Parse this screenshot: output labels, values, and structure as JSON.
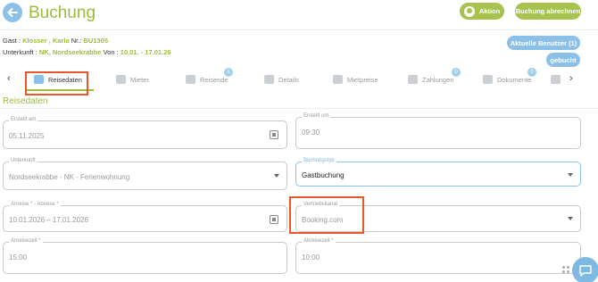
{
  "header": {
    "title": "Buchung",
    "aktion_label": "Aktion",
    "abrechnen_label": "Buchung abrechnen"
  },
  "info": {
    "gast_label": "Gast :",
    "gast_value": "Klosser , Karla",
    "nr_label": "Nr.:",
    "nr_value": "BU1305",
    "unterkunft_label": "Unterkunft :",
    "unterkunft_value": "NK, Nordseekrabbe",
    "von_label": "Von :",
    "von_value": "10.01. - 17.01.26"
  },
  "pills": {
    "users": "Aktuelle Benutzer (1)",
    "status": "gebucht"
  },
  "tabs": [
    {
      "label": "Reisedaten",
      "badge": ""
    },
    {
      "label": "Mieter",
      "badge": ""
    },
    {
      "label": "Reisende",
      "badge": "0"
    },
    {
      "label": "Details",
      "badge": ""
    },
    {
      "label": "Mietpreise",
      "badge": ""
    },
    {
      "label": "Zahlungen",
      "badge": "0"
    },
    {
      "label": "Dokumente",
      "badge": "0"
    }
  ],
  "section": {
    "title": "Reisedaten"
  },
  "fields": {
    "erstellt_am": {
      "label": "Erstellt am",
      "value": "05.11.2025"
    },
    "erstellt_um": {
      "label": "Erstellt um",
      "value": "09:30"
    },
    "unterkunft": {
      "label": "Unterkunft",
      "value": "Nordseekrabbe - NK - Ferienwohnung"
    },
    "buchungstyp": {
      "label": "Buchungstyp",
      "value": "Gastbuchung"
    },
    "anreise_abreise": {
      "label": "Anreise * - Abreise *",
      "value": "10.01.2026 – 17.01.2026"
    },
    "vertriebskanal": {
      "label": "Vertriebskanal",
      "value": "Booking.com"
    },
    "anreisezeit": {
      "label": "Anreisezeit *",
      "value": "15:00"
    },
    "abreisezeit": {
      "label": "Abreisezeit *",
      "value": "10:00"
    }
  },
  "colors": {
    "brand_green": "#9dbb3c",
    "accent_blue": "#8cc0e8",
    "highlight": "#e8572a"
  }
}
